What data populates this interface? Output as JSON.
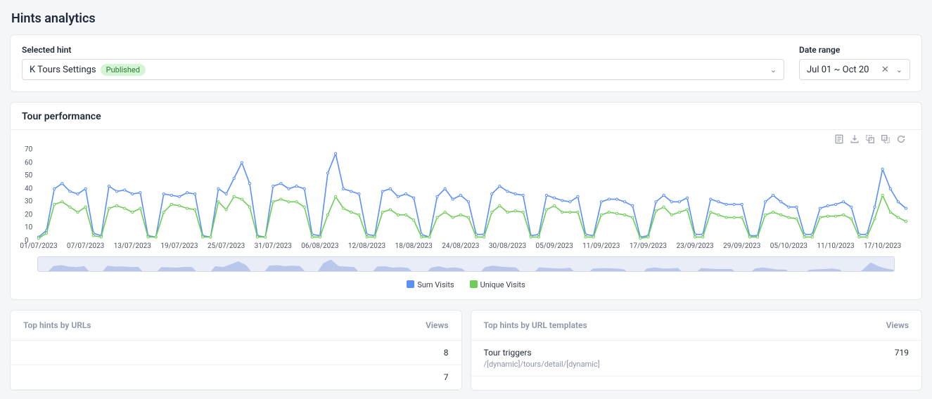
{
  "page_title": "Hints analytics",
  "filters": {
    "hint_label": "Selected hint",
    "hint_value": "K Tours Settings",
    "hint_badge": "Published",
    "date_label": "Date range",
    "date_value": "Jul 01 ~ Oct 20"
  },
  "chart_section_title": "Tour performance",
  "legend": {
    "sum": "Sum Visits",
    "unique": "Unique Visits"
  },
  "toolbar": {
    "data_view": "Data View",
    "save_image": "Save as Image",
    "area_zoom": "Area zooming",
    "reset_zoom": "Reset area zooming",
    "refresh": "Refresh"
  },
  "colors": {
    "sum": "#5b8ff9",
    "unique": "#6dce57"
  },
  "tables": {
    "urls_title": "Top hints by URLs",
    "templates_title": "Top hints by URL templates",
    "views_label": "Views",
    "url_rows": [
      {
        "title": "",
        "sub": "",
        "views": "8"
      },
      {
        "title": "",
        "sub": "",
        "views": "7"
      }
    ],
    "template_rows": [
      {
        "title": "Tour triggers",
        "sub": "/[dynamic]/tours/detail/[dynamic]",
        "views": "719"
      }
    ]
  },
  "chart_data": {
    "type": "line",
    "xlabel": "",
    "ylabel": "",
    "ylim": [
      0,
      70
    ],
    "yticks": [
      0,
      10,
      20,
      30,
      40,
      50,
      60,
      70
    ],
    "x_ticks": [
      "01/07/2023",
      "07/07/2023",
      "13/07/2023",
      "19/07/2023",
      "25/07/2023",
      "31/07/2023",
      "06/08/2023",
      "12/08/2023",
      "18/08/2023",
      "24/08/2023",
      "30/08/2023",
      "05/09/2023",
      "11/09/2023",
      "17/09/2023",
      "23/09/2023",
      "29/09/2023",
      "05/10/2023",
      "11/10/2023",
      "17/10/2023"
    ],
    "x_tick_idx": [
      0,
      6,
      12,
      18,
      24,
      30,
      36,
      42,
      48,
      54,
      60,
      66,
      72,
      78,
      84,
      90,
      96,
      102,
      108
    ],
    "n": 112,
    "series": [
      {
        "name": "Sum Visits",
        "color": "#5b8ff9",
        "values": [
          3,
          8,
          40,
          44,
          38,
          36,
          40,
          6,
          4,
          42,
          38,
          39,
          36,
          37,
          4,
          3,
          36,
          35,
          34,
          37,
          36,
          4,
          3,
          40,
          36,
          48,
          60,
          44,
          4,
          3,
          42,
          44,
          40,
          42,
          40,
          5,
          4,
          52,
          67,
          40,
          38,
          36,
          5,
          4,
          38,
          40,
          34,
          36,
          33,
          5,
          3,
          34,
          40,
          32,
          35,
          30,
          5,
          5,
          36,
          42,
          38,
          36,
          35,
          4,
          5,
          35,
          33,
          31,
          30,
          34,
          5,
          4,
          30,
          32,
          32,
          30,
          27,
          3,
          4,
          30,
          35,
          30,
          30,
          33,
          5,
          5,
          32,
          30,
          28,
          28,
          28,
          4,
          4,
          30,
          35,
          30,
          26,
          26,
          5,
          5,
          25,
          27,
          28,
          30,
          26,
          5,
          5,
          26,
          55,
          40,
          30,
          25
        ]
      },
      {
        "name": "Unique Visits",
        "color": "#6dce57",
        "values": [
          2,
          6,
          28,
          30,
          26,
          22,
          26,
          4,
          3,
          25,
          27,
          25,
          22,
          25,
          3,
          3,
          22,
          28,
          27,
          25,
          24,
          3,
          3,
          30,
          24,
          34,
          32,
          26,
          3,
          3,
          30,
          32,
          30,
          30,
          26,
          3,
          3,
          20,
          34,
          25,
          22,
          20,
          3,
          3,
          22,
          24,
          20,
          20,
          16,
          3,
          3,
          18,
          22,
          18,
          20,
          18,
          3,
          3,
          22,
          27,
          22,
          23,
          22,
          3,
          3,
          24,
          27,
          22,
          22,
          22,
          3,
          3,
          20,
          22,
          21,
          20,
          18,
          2,
          3,
          23,
          26,
          20,
          22,
          24,
          3,
          3,
          22,
          20,
          18,
          18,
          18,
          3,
          3,
          20,
          22,
          20,
          18,
          17,
          3,
          3,
          18,
          19,
          19,
          20,
          17,
          3,
          3,
          17,
          35,
          22,
          18,
          15
        ]
      }
    ]
  }
}
